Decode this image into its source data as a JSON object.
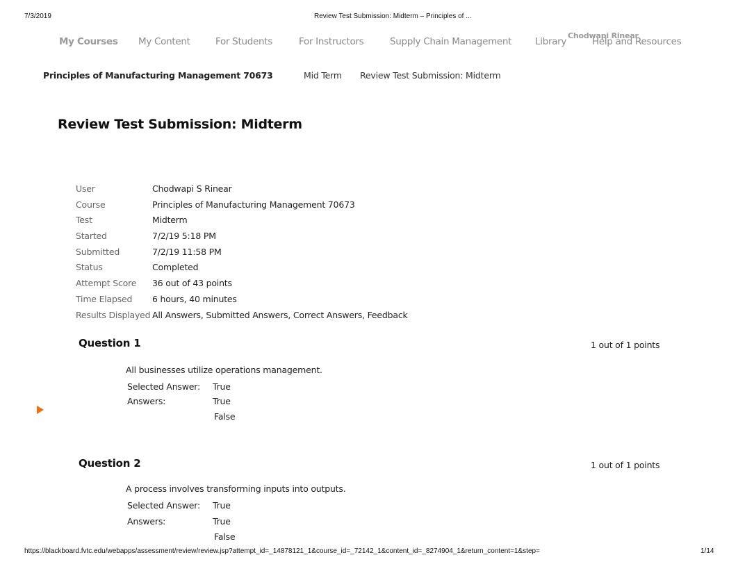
{
  "print_header": {
    "date": "7/3/2019",
    "title": "Review Test Submission: Midterm – Principles of ..."
  },
  "nav": {
    "items": [
      {
        "label": "My Courses",
        "active": true
      },
      {
        "label": "My Content"
      },
      {
        "label": "For Students"
      },
      {
        "label": "For Instructors"
      },
      {
        "label": "Supply Chain Management"
      },
      {
        "label": "Library"
      },
      {
        "label": "Help and Resources"
      }
    ],
    "user_name": "Chodwapi Rinear"
  },
  "breadcrumb": {
    "course": "Principles of Manufacturing Management 70673",
    "items": [
      "Mid Term",
      "Review Test Submission: Midterm"
    ]
  },
  "page": {
    "title": "Review Test Submission: Midterm"
  },
  "summary": [
    {
      "label": "User",
      "value": "Chodwapi S Rinear"
    },
    {
      "label": "Course",
      "value": "Principles of Manufacturing Management 70673"
    },
    {
      "label": "Test",
      "value": "Midterm"
    },
    {
      "label": "Started",
      "value": "7/2/19 5:18 PM"
    },
    {
      "label": "Submitted",
      "value": "7/2/19 11:58 PM"
    },
    {
      "label": "Status",
      "value": "Completed"
    },
    {
      "label": "Attempt Score",
      "value": "36 out of 43 points"
    },
    {
      "label": "Time Elapsed",
      "value": "6 hours, 40 minutes"
    },
    {
      "label": "Results Displayed",
      "value": "All Answers, Submitted Answers, Correct Answers, Feedback"
    }
  ],
  "questions": [
    {
      "title": "Question 1",
      "points": "1 out of 1 points",
      "text": "All businesses utilize operations management.",
      "selected_label": "Selected Answer:",
      "selected_answer": "True",
      "answers_label": "Answers:",
      "answers": [
        "True",
        "False"
      ]
    },
    {
      "title": "Question 2",
      "points": "1 out of 1 points",
      "text": "A process involves transforming inputs into outputs.",
      "selected_label": "Selected Answer:",
      "selected_answer": "True",
      "answers_label": "Answers:",
      "answers": [
        "True",
        "False"
      ]
    }
  ],
  "colors": {
    "accent": "#f07010",
    "nav_text": "#8a8a8a"
  },
  "print_footer": {
    "url": "https://blackboard.fvtc.edu/webapps/assessment/review/review.jsp?attempt_id=_14878121_1&course_id=_72142_1&content_id=_8274904_1&return_content=1&step=",
    "page": "1/14"
  }
}
